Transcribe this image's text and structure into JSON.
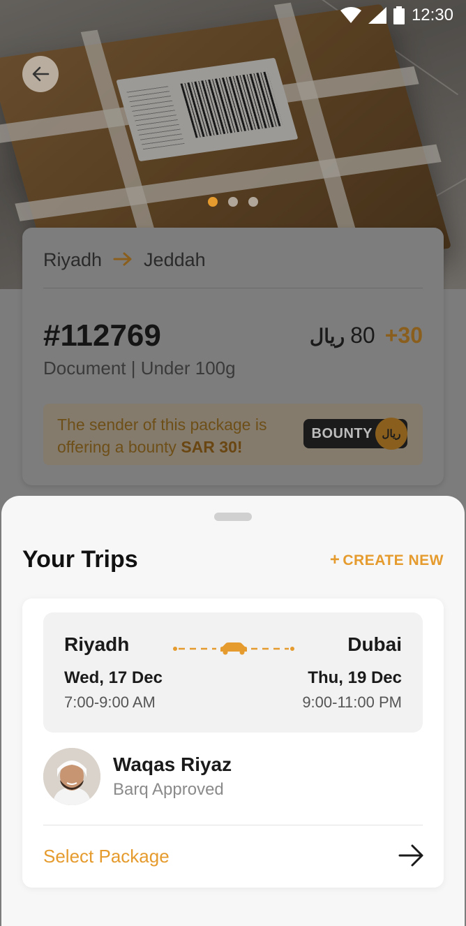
{
  "status_bar": {
    "time": "12:30"
  },
  "hero": {
    "carousel_total": 3,
    "carousel_active": 1
  },
  "package": {
    "origin": "Riyadh",
    "destination": "Jeddah",
    "id": "#112769",
    "currency_symbol": "ريال",
    "price": "80",
    "bounty_plus": "+30",
    "meta": "Document | Under 100g",
    "bounty_message_prefix": "The sender of this package is offering a bounty ",
    "bounty_message_amount": "SAR 30!",
    "bounty_badge": "BOUNTY",
    "bounty_seal": "ريال"
  },
  "sheet": {
    "title": "Your Trips",
    "create_new_label": "CREATE NEW"
  },
  "trip": {
    "from_city": "Riyadh",
    "to_city": "Dubai",
    "from_date": "Wed, 17 Dec",
    "to_date": "Thu, 19 Dec",
    "from_time": "7:00-9:00 AM",
    "to_time": "9:00-11:00 PM",
    "traveler_name": "Waqas Riyaz",
    "traveler_status": "Barq Approved",
    "select_label": "Select Package"
  },
  "colors": {
    "accent": "#e59b2d",
    "accent_dimmed": "#8a5f1e",
    "text": "#1a1a1a"
  },
  "icons": {
    "back": "arrow-left-icon",
    "wifi": "wifi-icon",
    "signal": "signal-icon",
    "battery": "battery-icon",
    "route_arrow": "arrow-right-icon",
    "car": "car-icon",
    "go": "arrow-right-icon"
  }
}
